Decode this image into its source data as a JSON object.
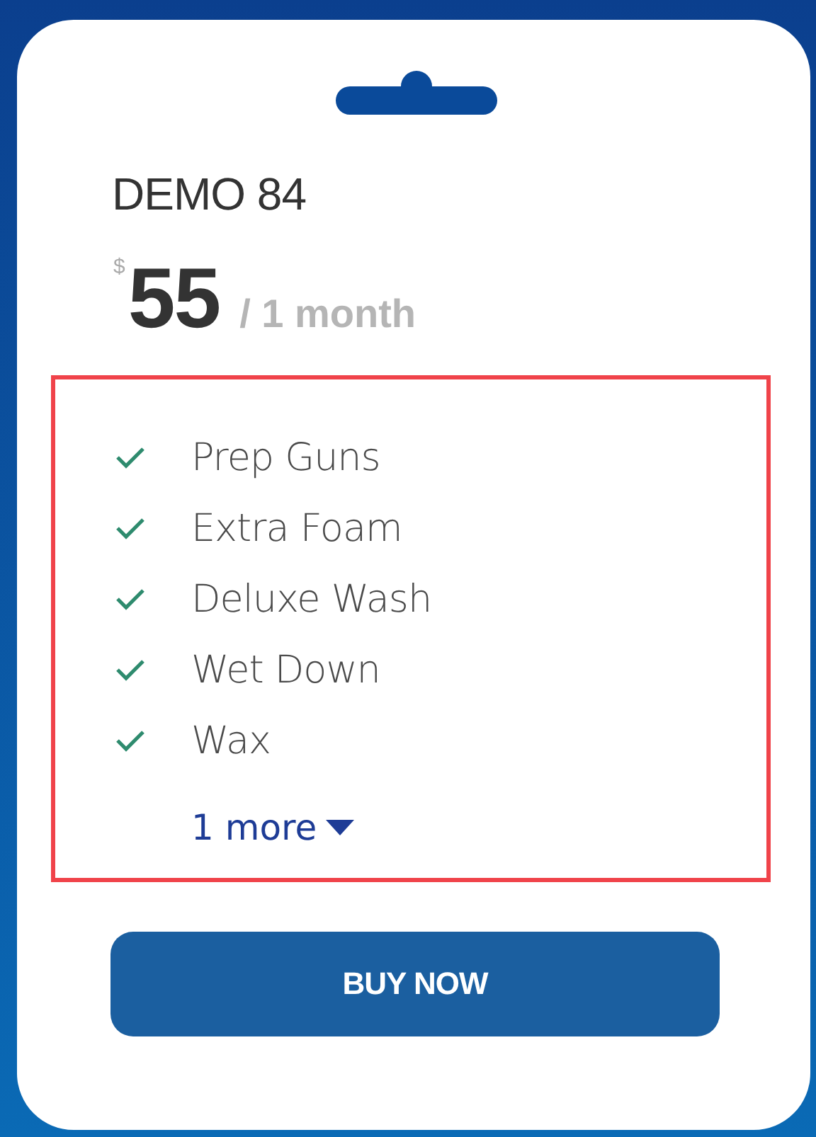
{
  "plan": {
    "title": "DEMO 84",
    "price": {
      "currency": "$",
      "amount": "55",
      "period": "/ 1 month"
    },
    "features": [
      {
        "label": "Prep Guns"
      },
      {
        "label": "Extra Foam"
      },
      {
        "label": "Deluxe Wash"
      },
      {
        "label": "Wet Down"
      },
      {
        "label": "Wax"
      }
    ],
    "more_link": "1 more",
    "button": "BUY NOW"
  }
}
